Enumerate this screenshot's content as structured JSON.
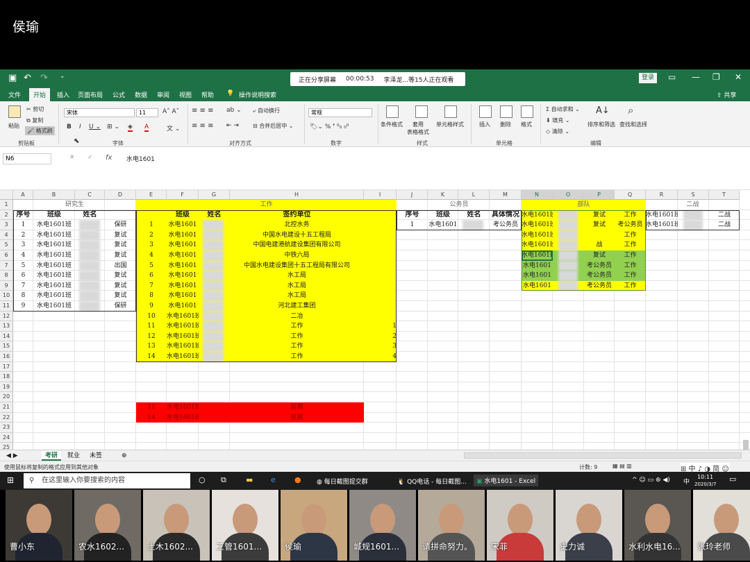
{
  "presenter": "侯瑜",
  "excel": {
    "share_status": "正在分享屏幕",
    "share_time": "00:00:53",
    "share_viewers": "李泽龙...等15人正在观看",
    "login": "登录",
    "share_btn": "共享",
    "menu": [
      "文件",
      "开始",
      "插入",
      "页面布局",
      "公式",
      "数据",
      "审阅",
      "视图",
      "帮助",
      "操作说明搜索"
    ],
    "ribbon": {
      "clipboard": {
        "paste": "粘贴",
        "cut": "剪切",
        "copy": "复制",
        "painter": "格式刷",
        "label": "剪贴板"
      },
      "font": {
        "name": "宋体",
        "size": "11",
        "label": "字体"
      },
      "align": {
        "wrap": "自动换行",
        "merge": "合并后居中",
        "label": "对齐方式"
      },
      "number": {
        "format": "常规",
        "label": "数字"
      },
      "styles": {
        "cond": "条件格式",
        "table": "套用\n表格格式",
        "cell": "单元格样式",
        "label": "样式"
      },
      "cells": {
        "insert": "插入",
        "delete": "删除",
        "format": "格式",
        "label": "单元格"
      },
      "editing": {
        "autosum": "自动求和",
        "fill": "填充",
        "clear": "清除",
        "sort": "排序和筛选",
        "find": "查找和选择",
        "label": "编辑"
      }
    },
    "namebox": "N6",
    "formula": "水电1601",
    "columns": [
      "A",
      "B",
      "C",
      "D",
      "E",
      "F",
      "G",
      "H",
      "I",
      "J",
      "K",
      "L",
      "M",
      "N",
      "O",
      "P",
      "Q",
      "R",
      "S",
      "T"
    ],
    "rows": [
      "1",
      "2",
      "3",
      "4",
      "5",
      "6",
      "7",
      "8",
      "9",
      "10",
      "11",
      "12",
      "13",
      "14",
      "15",
      "16",
      "17",
      "18",
      "19",
      "20",
      "21",
      "22",
      "23",
      "24",
      "25"
    ],
    "sections": {
      "grad": "研究生",
      "work": "工作",
      "civil": "公务员",
      "army": "部队",
      "second": "二战"
    },
    "grad_headers": [
      "序号",
      "班级",
      "姓名"
    ],
    "grad_rows": [
      {
        "no": "1",
        "cls": "水电1601班",
        "type": "保研"
      },
      {
        "no": "2",
        "cls": "水电1601班",
        "type": "复试"
      },
      {
        "no": "3",
        "cls": "水电1601班",
        "type": "复试"
      },
      {
        "no": "4",
        "cls": "水电1601班",
        "type": "复试"
      },
      {
        "no": "5",
        "cls": "水电1601班",
        "type": "出国"
      },
      {
        "no": "6",
        "cls": "水电1601班",
        "type": "复试"
      },
      {
        "no": "7",
        "cls": "水电1601班",
        "type": "复试"
      },
      {
        "no": "8",
        "cls": "水电1601班",
        "type": "复试"
      },
      {
        "no": "9",
        "cls": "水电1601班",
        "type": "保研"
      }
    ],
    "work_headers": [
      "班级",
      "姓名",
      "签约单位"
    ],
    "work_rows": [
      {
        "no": "1",
        "cls": "水电1601",
        "unit": "北控水务",
        "i": ""
      },
      {
        "no": "2",
        "cls": "水电1601",
        "unit": "中国水电建设十五工程局",
        "i": ""
      },
      {
        "no": "3",
        "cls": "水电1601",
        "unit": "中国电建港航建设集团有限公司",
        "i": ""
      },
      {
        "no": "4",
        "cls": "水电1601",
        "unit": "中铁六局",
        "i": ""
      },
      {
        "no": "5",
        "cls": "水电1601",
        "unit": "中国水电建设集团十五工程局有限公司",
        "i": ""
      },
      {
        "no": "6",
        "cls": "水电1601",
        "unit": "水工局",
        "i": ""
      },
      {
        "no": "7",
        "cls": "水电1601",
        "unit": "水工局",
        "i": ""
      },
      {
        "no": "8",
        "cls": "水电1601",
        "unit": "水工局",
        "i": ""
      },
      {
        "no": "9",
        "cls": "水电1601",
        "unit": "河北建工集团",
        "i": ""
      },
      {
        "no": "10",
        "cls": "水电1601班",
        "unit": "二冶",
        "i": ""
      },
      {
        "no": "11",
        "cls": "水电1601班",
        "unit": "工作",
        "i": "1"
      },
      {
        "no": "12",
        "cls": "水电1601班",
        "unit": "工作",
        "i": "2"
      },
      {
        "no": "13",
        "cls": "水电1601班",
        "unit": "工作",
        "i": "3"
      },
      {
        "no": "14",
        "cls": "水电1601班",
        "unit": "工作",
        "i": "4"
      }
    ],
    "red_rows": [
      {
        "no": "11",
        "cls": "水电1601班",
        "unit": "延期"
      },
      {
        "no": "14",
        "cls": "水电1601班",
        "unit": "延期"
      }
    ],
    "civil_headers": [
      "序号",
      "班级",
      "姓名",
      "具体情况"
    ],
    "civil_row": {
      "no": "1",
      "cls": "水电1601",
      "detail": "考公务员"
    },
    "army_rows": [
      {
        "n": "水电1601班",
        "p": "复试",
        "q": "工作",
        "r": "水电1601班",
        "t": "二战"
      },
      {
        "n": "水电1601班",
        "p": "复试",
        "q": "考公务员",
        "r": "水电1601班",
        "t": "二战"
      },
      {
        "n": "水电1601班",
        "p": "",
        "q": "工作",
        "r": "",
        "t": ""
      },
      {
        "n": "水电1601班",
        "p": "战",
        "q": "工作",
        "r": "",
        "t": ""
      },
      {
        "n": "水电1601班",
        "p": "复试",
        "q": "工作",
        "r": "",
        "t": ""
      },
      {
        "n": "水电1601",
        "p": "考公务员",
        "q": "工作",
        "r": "",
        "t": ""
      },
      {
        "n": "水电1601",
        "p": "考公务员",
        "q": "工作",
        "r": "",
        "t": ""
      },
      {
        "n": "水电1601",
        "p": "考公务员",
        "q": "工作",
        "r": "",
        "t": ""
      }
    ],
    "sheets": [
      "考研",
      "就业",
      "未签"
    ],
    "status_left": "使用鼠标将复制的格式应用到其他对象",
    "status_count": "计数: 9"
  },
  "taskbar": {
    "search": "在这里输入你要搜索的内容",
    "apps": [
      "每日截图提交群",
      "QQ电话 - 每日截图...",
      "水电1601 - Excel"
    ],
    "time": "10:11",
    "date": "2020/3/7",
    "ime": "中"
  },
  "participants": [
    "曹小东",
    "农水1602...",
    "土木1602...",
    "工管1601...",
    "侯瑜",
    "城规1601...",
    "请拼命努力。",
    "宋菲",
    "史力诚",
    "水利水电16...",
    "张玲老师"
  ]
}
